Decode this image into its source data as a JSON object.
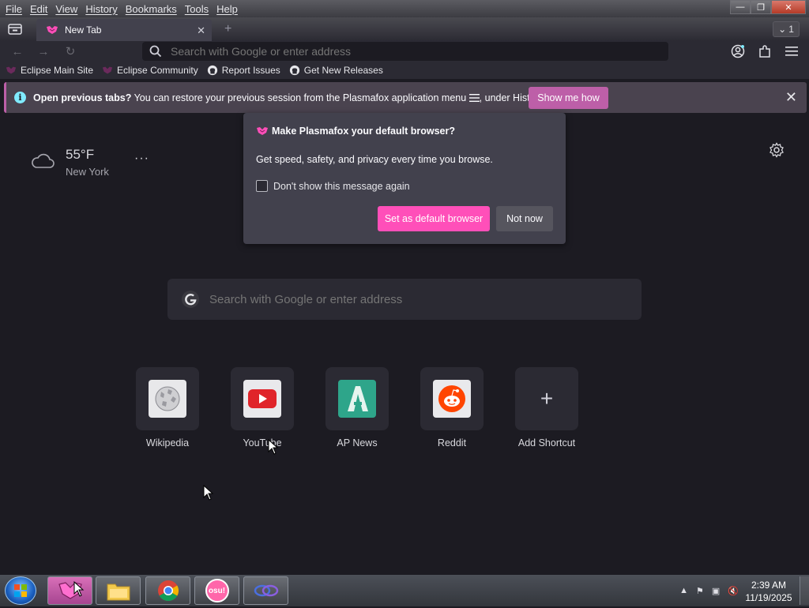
{
  "menubar": {
    "items": [
      "File",
      "Edit",
      "View",
      "History",
      "Bookmarks",
      "Tools",
      "Help"
    ]
  },
  "tab": {
    "title": "New Tab"
  },
  "alltabs": {
    "count": "1"
  },
  "urlbar": {
    "placeholder": "Search with Google or enter address"
  },
  "bookmarks": [
    {
      "label": "Eclipse Main Site",
      "icon": "plasmafox-icon"
    },
    {
      "label": "Eclipse Community",
      "icon": "plasmafox-icon"
    },
    {
      "label": "Report Issues",
      "icon": "github-icon"
    },
    {
      "label": "Get New Releases",
      "icon": "github-icon"
    }
  ],
  "notification": {
    "bold": "Open previous tabs?",
    "message": " You can restore your previous session from the Plasmafox application menu ",
    "message_tail": ", under History.",
    "button": "Show me how"
  },
  "weather": {
    "temperature": "55°F",
    "location": "New York",
    "more": "···"
  },
  "popup": {
    "title": "Make Plasmafox your default browser?",
    "body": "Get speed, safety, and privacy every time you browse.",
    "checkbox_label": "Don't show this message again",
    "primary_button": "Set as default browser",
    "secondary_button": "Not now"
  },
  "main_search": {
    "placeholder": "Search with Google or enter address"
  },
  "shortcuts": [
    {
      "label": "Wikipedia",
      "icon": "wikipedia-icon"
    },
    {
      "label": "YouTube",
      "icon": "youtube-icon"
    },
    {
      "label": "AP News",
      "icon": "apnews-icon"
    },
    {
      "label": "Reddit",
      "icon": "reddit-icon"
    },
    {
      "label": "Add Shortcut",
      "icon": "plus-icon"
    }
  ],
  "taskbar": {
    "apps": [
      "plasmafox-icon",
      "file-explorer-icon",
      "chrome-icon",
      "osu-icon",
      "eclipse-icon"
    ],
    "osu_text": "osu!",
    "time": "2:39 AM",
    "date": "11/19/2025"
  },
  "colors": {
    "accent_pink": "#ff4fb9",
    "notification_button": "#bd5fa8",
    "background": "#1c1b22",
    "panel": "#42414d"
  }
}
